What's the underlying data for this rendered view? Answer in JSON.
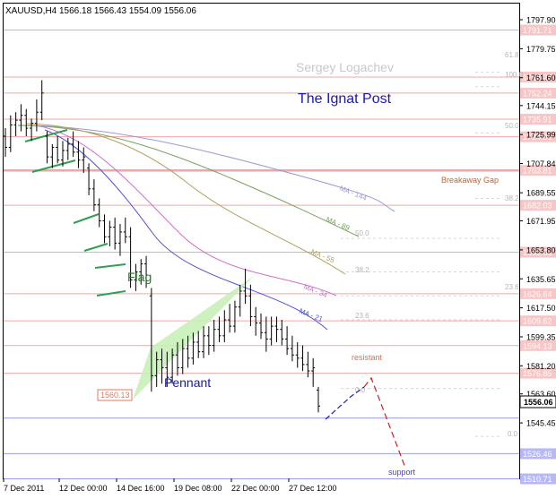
{
  "header": {
    "symbol": "XAUUSD,H4",
    "ohlc": "1566.18 1566.43 1554.09 1556.06"
  },
  "chart_data": {
    "type": "candlestick",
    "symbol": "XAUUSD",
    "timeframe": "H4",
    "ylim": [
      1510.71,
      1808.0
    ],
    "price_ticks": [
      1797.9,
      1779.75,
      1761.6,
      1744.15,
      1725.99,
      1707.84,
      1689.55,
      1671.95,
      1653.8,
      1635.65,
      1617.5,
      1599.35,
      1581.2,
      1563.6,
      1545.45
    ],
    "date_labels": [
      "7 Dec 2011",
      "12 Dec 00:00",
      "14 Dec 16:00",
      "19 Dec 08:00",
      "22 Dec 00:00",
      "27 Dec 12:00"
    ],
    "current_price": "1556.06",
    "level_lines": [
      "1791.71",
      "1762.27",
      "1752.24",
      "1735.91",
      "1724.91",
      "1703.81",
      "1682.03",
      "1652.61",
      "1626.64",
      "1609.62",
      "1594.13",
      "1576.85",
      "1526.46",
      "1510.71"
    ],
    "support_lines": [
      "1526.46",
      "1510.71"
    ],
    "fib_levels": [
      "61.8",
      "100.0",
      "50.0",
      "38.2",
      "50.0",
      "38.2",
      "23.6",
      "23.6",
      "0.0",
      "0.0"
    ],
    "moving_averages": [
      {
        "name": "MA - 144",
        "color": "#9a9ad8"
      },
      {
        "name": "MA - 89",
        "color": "#7aa060"
      },
      {
        "name": "MA - 55",
        "color": "#b0a060"
      },
      {
        "name": "MA - 34",
        "color": "#d070c8"
      },
      {
        "name": "MA - 21",
        "color": "#5050d8"
      }
    ],
    "annotations": {
      "watermark": "Sergey Logachev",
      "brand": "The Ignat Post",
      "breakaway_gap": "Breakaway Gap",
      "flag": "Flag",
      "pennant": "Pennant",
      "resistant": "resistant",
      "support": "support",
      "low_marker": "1560.13"
    },
    "candles": [
      [
        1725,
        1730,
        1712,
        1718
      ],
      [
        1718,
        1738,
        1715,
        1732
      ],
      [
        1732,
        1740,
        1725,
        1735
      ],
      [
        1735,
        1745,
        1728,
        1738
      ],
      [
        1738,
        1742,
        1725,
        1730
      ],
      [
        1730,
        1736,
        1722,
        1733
      ],
      [
        1733,
        1748,
        1728,
        1740
      ],
      [
        1740,
        1760,
        1735,
        1752
      ],
      [
        1725,
        1728,
        1708,
        1712
      ],
      [
        1712,
        1720,
        1705,
        1718
      ],
      [
        1718,
        1725,
        1708,
        1710
      ],
      [
        1710,
        1722,
        1706,
        1716
      ],
      [
        1716,
        1724,
        1710,
        1720
      ],
      [
        1720,
        1728,
        1712,
        1715
      ],
      [
        1715,
        1722,
        1705,
        1710
      ],
      [
        1710,
        1718,
        1702,
        1712
      ],
      [
        1705,
        1708,
        1688,
        1692
      ],
      [
        1692,
        1698,
        1678,
        1682
      ],
      [
        1682,
        1686,
        1668,
        1672
      ],
      [
        1672,
        1676,
        1658,
        1662
      ],
      [
        1662,
        1672,
        1656,
        1668
      ],
      [
        1668,
        1674,
        1654,
        1658
      ],
      [
        1658,
        1670,
        1650,
        1665
      ],
      [
        1665,
        1674,
        1658,
        1662
      ],
      [
        1662,
        1668,
        1630,
        1635
      ],
      [
        1635,
        1645,
        1628,
        1640
      ],
      [
        1640,
        1648,
        1632,
        1645
      ],
      [
        1645,
        1650,
        1630,
        1638
      ],
      [
        1625,
        1630,
        1565,
        1575
      ],
      [
        1575,
        1590,
        1568,
        1585
      ],
      [
        1585,
        1592,
        1570,
        1580
      ],
      [
        1580,
        1590,
        1568,
        1574
      ],
      [
        1574,
        1592,
        1570,
        1588
      ],
      [
        1588,
        1596,
        1575,
        1580
      ],
      [
        1580,
        1598,
        1576,
        1592
      ],
      [
        1592,
        1600,
        1580,
        1586
      ],
      [
        1586,
        1602,
        1582,
        1596
      ],
      [
        1596,
        1603,
        1586,
        1590
      ],
      [
        1590,
        1606,
        1586,
        1600
      ],
      [
        1600,
        1606,
        1588,
        1594
      ],
      [
        1594,
        1610,
        1590,
        1604
      ],
      [
        1604,
        1612,
        1596,
        1600
      ],
      [
        1600,
        1616,
        1596,
        1610
      ],
      [
        1610,
        1620,
        1602,
        1606
      ],
      [
        1606,
        1622,
        1602,
        1618
      ],
      [
        1618,
        1632,
        1612,
        1628
      ],
      [
        1628,
        1642,
        1620,
        1625
      ],
      [
        1625,
        1632,
        1606,
        1612
      ],
      [
        1612,
        1618,
        1600,
        1608
      ],
      [
        1608,
        1614,
        1598,
        1602
      ],
      [
        1602,
        1612,
        1590,
        1598
      ],
      [
        1598,
        1612,
        1594,
        1606
      ],
      [
        1606,
        1612,
        1596,
        1604
      ],
      [
        1604,
        1610,
        1594,
        1598
      ],
      [
        1598,
        1606,
        1588,
        1592
      ],
      [
        1592,
        1600,
        1584,
        1588
      ],
      [
        1588,
        1596,
        1580,
        1586
      ],
      [
        1586,
        1594,
        1578,
        1582
      ],
      [
        1582,
        1590,
        1574,
        1578
      ],
      [
        1578,
        1586,
        1568,
        1580
      ],
      [
        1566,
        1568,
        1552,
        1556
      ]
    ]
  }
}
